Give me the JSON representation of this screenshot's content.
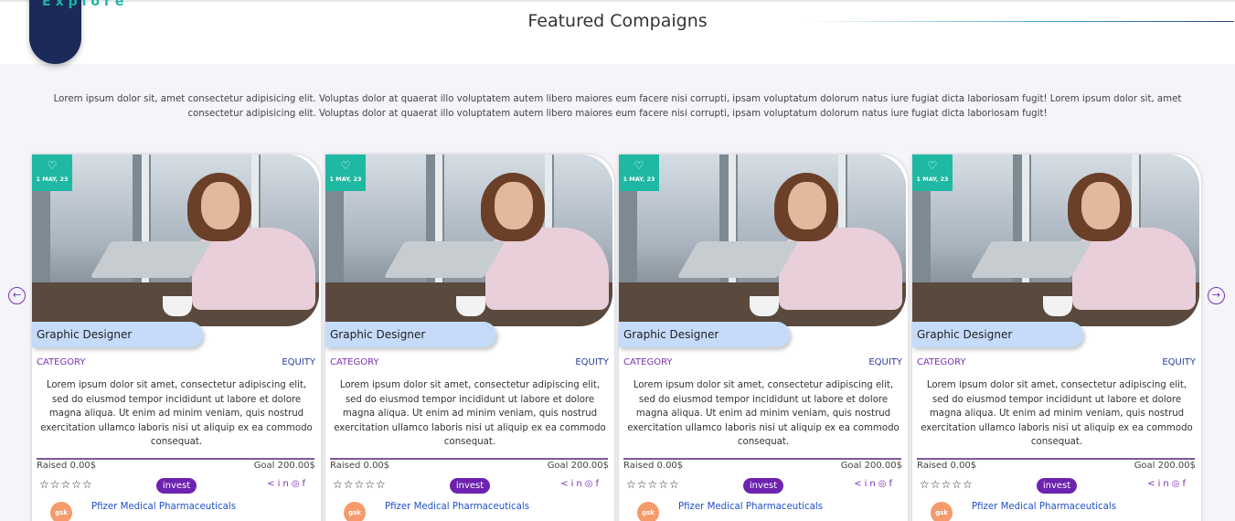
{
  "header": {
    "explore_label": "Explore",
    "title": "Featured Compaigns"
  },
  "intro": "Lorem ipsum dolor sit, amet consectetur adipisicing elit. Voluptas dolor at quaerat illo voluptatem autem libero maiores eum facere nisi corrupti, ipsam voluptatum dolorum natus iure fugiat dicta laboriosam fugit! Lorem ipsum dolor sit, amet consectetur adipisicing elit. Voluptas dolor at quaerat illo voluptatem autem libero maiores eum facere nisi corrupti, ipsam voluptatum dolorum natus iure fugiat dicta laboriosam fugit!",
  "nav": {
    "prev_icon": "arrow-left-circle-icon",
    "next_icon": "arrow-right-circle-icon"
  },
  "cards": [
    {
      "date": "1 MAY, 23",
      "title": "Graphic Designer",
      "category": "CATEGORY",
      "type": "EQUITY",
      "description": "Lorem ipsum dolor sit amet, consectetur adipiscing elit, sed do eiusmod tempor incididunt ut labore et dolore magna aliqua. Ut enim ad minim veniam, quis nostrud exercitation ullamco laboris nisi ut aliquip ex ea commodo consequat.",
      "raised": "Raised 0.00$",
      "goal": "Goal 200.00$",
      "rating": "☆☆☆☆☆",
      "invest_label": "invest",
      "org_logo": "gsk",
      "org_name": "Pfizer Medical Pharmaceuticals"
    },
    {
      "date": "1 MAY, 23",
      "title": "Graphic Designer",
      "category": "CATEGORY",
      "type": "EQUITY",
      "description": "Lorem ipsum dolor sit amet, consectetur adipiscing elit, sed do eiusmod tempor incididunt ut labore et dolore magna aliqua. Ut enim ad minim veniam, quis nostrud exercitation ullamco laboris nisi ut aliquip ex ea commodo consequat.",
      "raised": "Raised 0.00$",
      "goal": "Goal 200.00$",
      "rating": "☆☆☆☆☆",
      "invest_label": "invest",
      "org_logo": "gsk",
      "org_name": "Pfizer Medical Pharmaceuticals"
    },
    {
      "date": "1 MAY, 23",
      "title": "Graphic Designer",
      "category": "CATEGORY",
      "type": "EQUITY",
      "description": "Lorem ipsum dolor sit amet, consectetur adipiscing elit, sed do eiusmod tempor incididunt ut labore et dolore magna aliqua. Ut enim ad minim veniam, quis nostrud exercitation ullamco laboris nisi ut aliquip ex ea commodo consequat.",
      "raised": "Raised 0.00$",
      "goal": "Goal 200.00$",
      "rating": "☆☆☆☆☆",
      "invest_label": "invest",
      "org_logo": "gsk",
      "org_name": "Pfizer Medical Pharmaceuticals"
    },
    {
      "date": "1 MAY, 23",
      "title": "Graphic Designer",
      "category": "CATEGORY",
      "type": "EQUITY",
      "description": "Lorem ipsum dolor sit amet, consectetur adipiscing elit, sed do eiusmod tempor incididunt ut labore et dolore magna aliqua. Ut enim ad minim veniam, quis nostrud exercitation ullamco laboris nisi ut aliquip ex ea commodo consequat.",
      "raised": "Raised 0.00$",
      "goal": "Goal 200.00$",
      "rating": "☆☆☆☆☆",
      "invest_label": "invest",
      "org_logo": "gsk",
      "org_name": "Pfizer Medical Pharmaceuticals"
    }
  ],
  "colors": {
    "teal": "#1fb9a3",
    "navy": "#1c2a5a",
    "purple": "#6d22b0",
    "link_blue": "#1f4fc9",
    "pill_blue": "#c5dbf9"
  }
}
